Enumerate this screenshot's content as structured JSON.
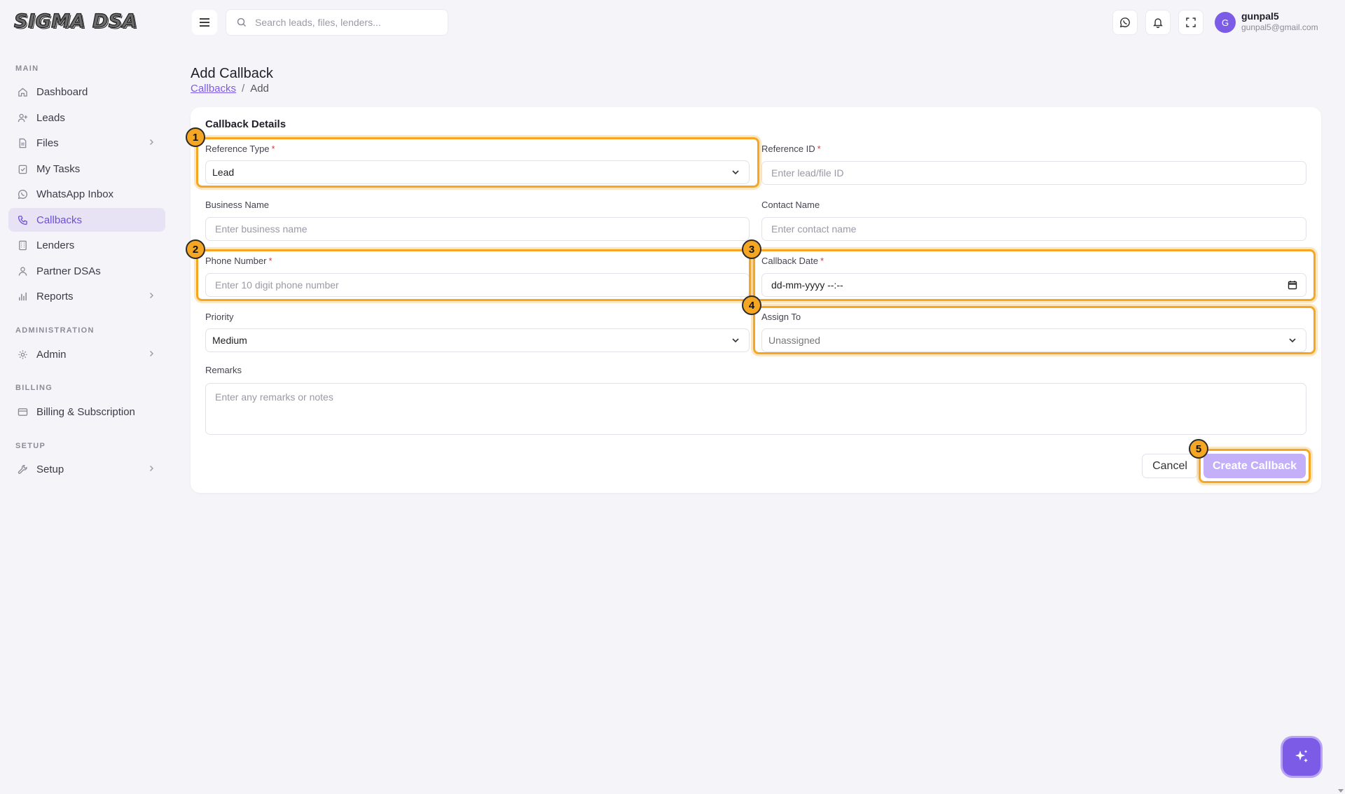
{
  "app": {
    "logo_text": "SIGMA DSA"
  },
  "sidebar": {
    "sections": {
      "main": "MAIN",
      "administration": "ADMINISTRATION",
      "billing": "BILLING",
      "setup": "SETUP"
    },
    "items": [
      {
        "label": "Dashboard",
        "icon": "home-icon"
      },
      {
        "label": "Leads",
        "icon": "user-plus-icon"
      },
      {
        "label": "Files",
        "icon": "file-icon",
        "has_children": true
      },
      {
        "label": "My Tasks",
        "icon": "clipboard-check-icon"
      },
      {
        "label": "WhatsApp Inbox",
        "icon": "whatsapp-icon"
      },
      {
        "label": "Callbacks",
        "icon": "phone-icon",
        "active": true
      },
      {
        "label": "Lenders",
        "icon": "building-icon"
      },
      {
        "label": "Partner DSAs",
        "icon": "users-icon"
      },
      {
        "label": "Reports",
        "icon": "bar-chart-icon",
        "has_children": true
      },
      {
        "label": "Admin",
        "icon": "gear-icon",
        "has_children": true
      },
      {
        "label": "Billing & Subscription",
        "icon": "credit-card-icon"
      },
      {
        "label": "Setup",
        "icon": "wrench-icon",
        "has_children": true
      }
    ]
  },
  "header": {
    "search_placeholder": "Search leads, files, lenders...",
    "user": {
      "initial": "G",
      "name": "gunpal5",
      "email": "gunpal5@gmail.com"
    }
  },
  "page": {
    "title": "Add Callback",
    "breadcrumb": {
      "parent": "Callbacks",
      "separator": "/",
      "current": "Add"
    }
  },
  "form": {
    "card_title": "Callback Details",
    "reference_type": {
      "label": "Reference Type",
      "value": "Lead",
      "required": "*"
    },
    "reference_id": {
      "label": "Reference ID",
      "placeholder": "Enter lead/file ID",
      "required": "*"
    },
    "business_name": {
      "label": "Business Name",
      "placeholder": "Enter business name"
    },
    "contact_name": {
      "label": "Contact Name",
      "placeholder": "Enter contact name"
    },
    "phone_number": {
      "label": "Phone Number",
      "placeholder": "Enter 10 digit phone number",
      "required": "*"
    },
    "callback_date": {
      "label": "Callback Date",
      "value": "dd-mm-yyyy --:--",
      "required": "*"
    },
    "priority": {
      "label": "Priority",
      "value": "Medium"
    },
    "assign_to": {
      "label": "Assign To",
      "value": "Unassigned"
    },
    "remarks": {
      "label": "Remarks",
      "placeholder": "Enter any remarks or notes"
    },
    "cancel_label": "Cancel",
    "submit_label": "Create Callback"
  },
  "annotations": {
    "badges": [
      "1",
      "2",
      "3",
      "4",
      "5"
    ],
    "highlight_color": "#f5a623"
  },
  "colors": {
    "accent": "#7c5ce6",
    "active_nav_bg": "#e7e3f4",
    "submit_disabled": "#c3b0f8",
    "required": "#e0334a"
  }
}
